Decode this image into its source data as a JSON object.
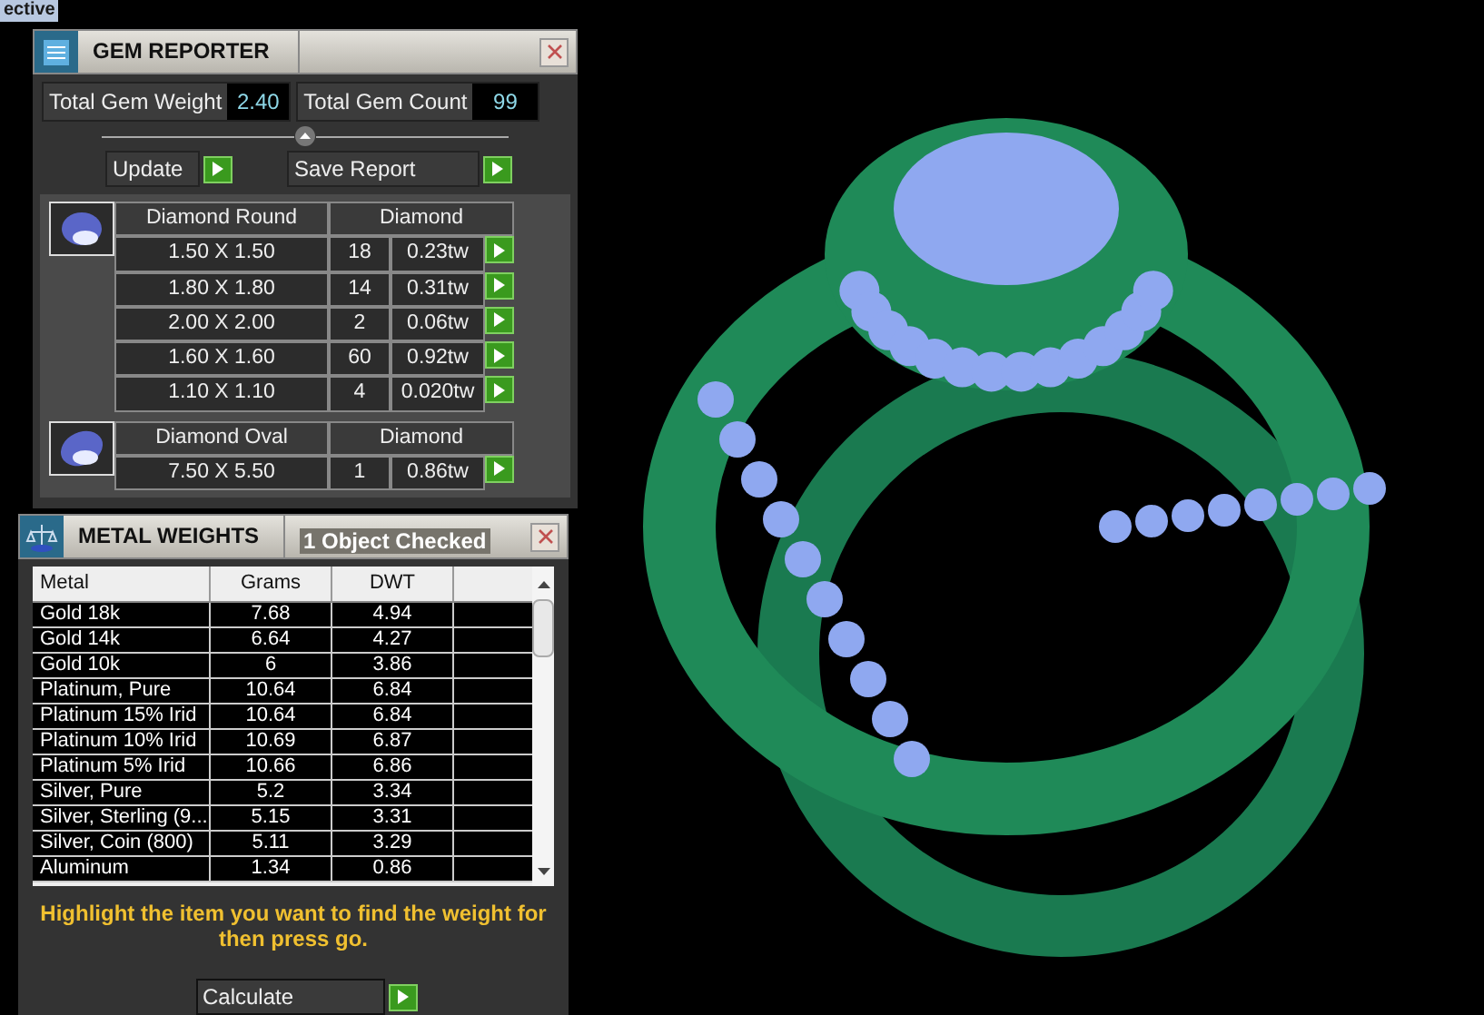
{
  "top_label": "ective",
  "gem_reporter": {
    "title": "GEM REPORTER",
    "total_weight": {
      "label": "Total Gem Weight",
      "value": "2.40"
    },
    "total_count": {
      "label": "Total Gem Count",
      "value": "99"
    },
    "buttons": [
      "Update",
      "Save Report"
    ],
    "groups": [
      {
        "kind": "round",
        "name": "Diamond Round",
        "material": "Diamond",
        "rows": [
          {
            "size": "1.50 X 1.50",
            "count": "18",
            "weight": "0.23tw"
          },
          {
            "size": "1.80 X 1.80",
            "count": "14",
            "weight": "0.31tw"
          },
          {
            "size": "2.00 X 2.00",
            "count": "2",
            "weight": "0.06tw"
          },
          {
            "size": "1.60 X 1.60",
            "count": "60",
            "weight": "0.92tw"
          },
          {
            "size": "1.10 X 1.10",
            "count": "4",
            "weight": "0.020tw"
          }
        ]
      },
      {
        "kind": "oval",
        "name": "Diamond Oval",
        "material": "Diamond",
        "rows": [
          {
            "size": "7.50 X 5.50",
            "count": "1",
            "weight": "0.86tw"
          }
        ]
      }
    ]
  },
  "metal_weights": {
    "title": "METAL WEIGHTS",
    "status": "1 Object Checked",
    "columns": [
      "Metal",
      "Grams",
      "DWT"
    ],
    "rows": [
      [
        "Gold 18k",
        "7.68",
        "4.94"
      ],
      [
        "Gold 14k",
        "6.64",
        "4.27"
      ],
      [
        "Gold 10k",
        "6",
        "3.86"
      ],
      [
        "Platinum, Pure",
        "10.64",
        "6.84"
      ],
      [
        "Platinum 15% Irid",
        "10.64",
        "6.84"
      ],
      [
        "Platinum 10% Irid",
        "10.69",
        "6.87"
      ],
      [
        "Platinum 5% Irid",
        "10.66",
        "6.86"
      ],
      [
        "Silver, Pure",
        "5.2",
        "3.34"
      ],
      [
        "Silver, Sterling (9...",
        "5.15",
        "3.31"
      ],
      [
        "Silver, Coin (800)",
        "5.11",
        "3.29"
      ],
      [
        "Aluminum",
        "1.34",
        "0.86"
      ]
    ],
    "hint": "Highlight the item you want to find the weight for then press go.",
    "button": "Calculate"
  }
}
